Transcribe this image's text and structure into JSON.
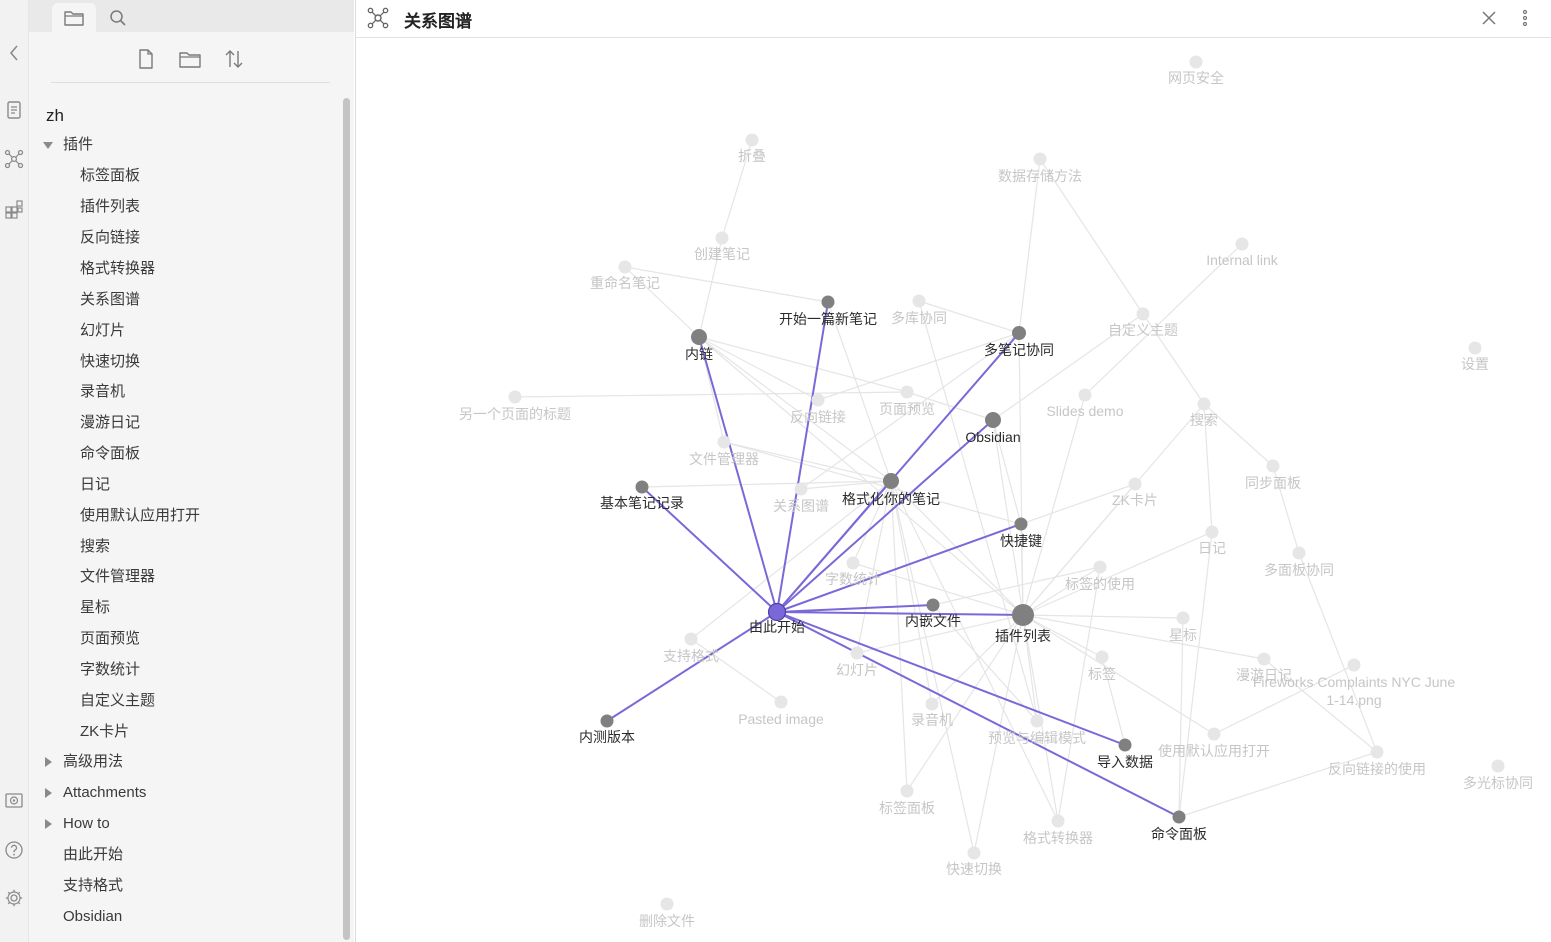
{
  "ribbon": {
    "items": [
      {
        "icon": "chevron-left-icon"
      },
      {
        "icon": "open-quick-switcher-icon"
      },
      {
        "icon": "graph-view-icon"
      },
      {
        "icon": "plugins-grid-icon"
      },
      {
        "icon": "vault-icon"
      },
      {
        "icon": "help-icon"
      },
      {
        "icon": "settings-gear-icon"
      }
    ]
  },
  "sidebar": {
    "tabs": [
      {
        "icon": "folder-icon",
        "active": true
      },
      {
        "icon": "search-icon",
        "active": false
      }
    ],
    "actions": [
      {
        "icon": "new-note-icon"
      },
      {
        "icon": "new-folder-icon"
      },
      {
        "icon": "sort-icon"
      }
    ],
    "root": "zh",
    "folder_open": "插件",
    "plugin_items": [
      "标签面板",
      "插件列表",
      "反向链接",
      "格式转换器",
      "关系图谱",
      "幻灯片",
      "快速切换",
      "录音机",
      "漫游日记",
      "命令面板",
      "日记",
      "使用默认应用打开",
      "搜索",
      "文件管理器",
      "星标",
      "页面预览",
      "字数统计",
      "自定义主题",
      "ZK卡片"
    ],
    "folders_closed": [
      "高级用法",
      "Attachments",
      "How to"
    ],
    "files": [
      "由此开始",
      "支持格式",
      "Obsidian"
    ]
  },
  "view": {
    "title": "关系图谱",
    "icon": "graph-view-icon",
    "actions": [
      {
        "icon": "close-icon"
      },
      {
        "icon": "more-options-icon"
      }
    ]
  },
  "graph": {
    "colors": {
      "edge_active": "#7b68d8",
      "edge_faint": "#e5e5e5",
      "node_active": "#7b68d8",
      "node_linked": "#808080",
      "node_faint": "#e6e6e6",
      "label_dark": "#2b2b2b",
      "label_faint": "#c6c6c6"
    },
    "center": "由此开始",
    "nodes": [
      {
        "id": "由此开始",
        "state": "active"
      },
      {
        "id": "开始一篇新笔记",
        "state": "linked"
      },
      {
        "id": "内链",
        "state": "linked"
      },
      {
        "id": "多笔记协同",
        "state": "linked"
      },
      {
        "id": "Obsidian",
        "state": "linked"
      },
      {
        "id": "格式化你的笔记",
        "state": "linked"
      },
      {
        "id": "基本笔记记录",
        "state": "linked"
      },
      {
        "id": "快捷键",
        "state": "linked"
      },
      {
        "id": "内嵌文件",
        "state": "linked"
      },
      {
        "id": "插件列表",
        "state": "linked"
      },
      {
        "id": "内测版本",
        "state": "linked"
      },
      {
        "id": "导入数据",
        "state": "linked"
      },
      {
        "id": "命令面板",
        "state": "linked"
      },
      {
        "id": "网页安全",
        "state": "faint"
      },
      {
        "id": "折叠",
        "state": "faint"
      },
      {
        "id": "数据存储方法",
        "state": "faint"
      },
      {
        "id": "创建笔记",
        "state": "faint"
      },
      {
        "id": "Internal link",
        "state": "faint"
      },
      {
        "id": "重命名笔记",
        "state": "faint"
      },
      {
        "id": "多库协同",
        "state": "faint"
      },
      {
        "id": "自定义主题",
        "state": "faint"
      },
      {
        "id": "设置",
        "state": "faint"
      },
      {
        "id": "另一个页面的标题",
        "state": "faint"
      },
      {
        "id": "页面预览",
        "state": "faint"
      },
      {
        "id": "反向链接",
        "state": "faint"
      },
      {
        "id": "Slides demo",
        "state": "faint"
      },
      {
        "id": "搜索",
        "state": "faint"
      },
      {
        "id": "文件管理器",
        "state": "faint"
      },
      {
        "id": "同步面板",
        "state": "faint"
      },
      {
        "id": "ZK卡片",
        "state": "faint"
      },
      {
        "id": "关系图谱",
        "state": "faint"
      },
      {
        "id": "日记",
        "state": "faint"
      },
      {
        "id": "多面板协同",
        "state": "faint"
      },
      {
        "id": "字数统计",
        "state": "faint"
      },
      {
        "id": "标签的使用",
        "state": "faint"
      },
      {
        "id": "星标",
        "state": "faint"
      },
      {
        "id": "支持格式",
        "state": "faint"
      },
      {
        "id": "幻灯片",
        "state": "faint"
      },
      {
        "id": "标签",
        "state": "faint"
      },
      {
        "id": "漫游日记",
        "state": "faint"
      },
      {
        "id": "Fireworks Complaints NYC June 1-14.png",
        "state": "faint"
      },
      {
        "id": "Pasted image",
        "state": "faint"
      },
      {
        "id": "录音机",
        "state": "faint"
      },
      {
        "id": "预览与编辑模式",
        "state": "faint"
      },
      {
        "id": "使用默认应用打开",
        "state": "faint"
      },
      {
        "id": "反向链接的使用",
        "state": "faint"
      },
      {
        "id": "多光标协同",
        "state": "faint"
      },
      {
        "id": "标签面板",
        "state": "faint"
      },
      {
        "id": "格式转换器",
        "state": "faint"
      },
      {
        "id": "快速切换",
        "state": "faint"
      },
      {
        "id": "删除文件",
        "state": "faint"
      }
    ],
    "active_edges": [
      [
        "由此开始",
        "开始一篇新笔记"
      ],
      [
        "由此开始",
        "内链"
      ],
      [
        "由此开始",
        "多笔记协同"
      ],
      [
        "由此开始",
        "Obsidian"
      ],
      [
        "由此开始",
        "格式化你的笔记"
      ],
      [
        "由此开始",
        "基本笔记记录"
      ],
      [
        "由此开始",
        "快捷键"
      ],
      [
        "由此开始",
        "内嵌文件"
      ],
      [
        "由此开始",
        "插件列表"
      ],
      [
        "由此开始",
        "内测版本"
      ],
      [
        "由此开始",
        "导入数据"
      ],
      [
        "由此开始",
        "命令面板"
      ]
    ],
    "faint_edges": [
      [
        "折叠",
        "创建笔记"
      ],
      [
        "创建笔记",
        "内链"
      ],
      [
        "重命名笔记",
        "开始一篇新笔记"
      ],
      [
        "重命名笔记",
        "内链"
      ],
      [
        "数据存储方法",
        "多笔记协同"
      ],
      [
        "数据存储方法",
        "自定义主题"
      ],
      [
        "Internal link",
        "Slides demo"
      ],
      [
        "多库协同",
        "多笔记协同"
      ],
      [
        "多库协同",
        "预览与编辑模式"
      ],
      [
        "自定义主题",
        "搜索"
      ],
      [
        "自定义主题",
        "Obsidian"
      ],
      [
        "另一个页面的标题",
        "页面预览"
      ],
      [
        "内链",
        "页面预览"
      ],
      [
        "内链",
        "反向链接"
      ],
      [
        "内链",
        "文件管理器"
      ],
      [
        "反向链接",
        "多笔记协同"
      ],
      [
        "页面预览",
        "Obsidian"
      ],
      [
        "文件管理器",
        "格式化你的笔记"
      ],
      [
        "文件管理器",
        "快捷键"
      ],
      [
        "关系图谱",
        "格式化你的笔记"
      ],
      [
        "关系图谱",
        "多笔记协同"
      ],
      [
        "Slides demo",
        "插件列表"
      ],
      [
        "搜索",
        "插件列表"
      ],
      [
        "搜索",
        "同步面板"
      ],
      [
        "ZK卡片",
        "插件列表"
      ],
      [
        "ZK卡片",
        "快捷键"
      ],
      [
        "日记",
        "插件列表"
      ],
      [
        "日记",
        "命令面板"
      ],
      [
        "同步面板",
        "多面板协同"
      ],
      [
        "多面板协同",
        "反向链接的使用"
      ],
      [
        "标签的使用",
        "插件列表"
      ],
      [
        "标签的使用",
        "内嵌文件"
      ],
      [
        "字数统计",
        "插件列表"
      ],
      [
        "字数统计",
        "格式化你的笔记"
      ],
      [
        "星标",
        "插件列表"
      ],
      [
        "标签",
        "插件列表"
      ],
      [
        "标签",
        "导入数据"
      ],
      [
        "幻灯片",
        "插件列表"
      ],
      [
        "幻灯片",
        "格式化你的笔记"
      ],
      [
        "漫游日记",
        "插件列表"
      ],
      [
        "漫游日记",
        "反向链接的使用"
      ],
      [
        "录音机",
        "插件列表"
      ],
      [
        "录音机",
        "格式化你的笔记"
      ],
      [
        "预览与编辑模式",
        "插件列表"
      ],
      [
        "预览与编辑模式",
        "内嵌文件"
      ],
      [
        "使用默认应用打开",
        "插件列表"
      ],
      [
        "使用默认应用打开",
        "Fireworks Complaints NYC June 1-14.png"
      ],
      [
        "反向链接的使用",
        "命令面板"
      ],
      [
        "标签面板",
        "插件列表"
      ],
      [
        "格式转换器",
        "插件列表"
      ],
      [
        "格式转换器",
        "格式化你的笔记"
      ],
      [
        "格式转换器",
        "标签的使用"
      ],
      [
        "快速切换",
        "插件列表"
      ],
      [
        "快速切换",
        "格式化你的笔记"
      ],
      [
        "支持格式",
        "格式化你的笔记"
      ],
      [
        "支持格式",
        "Pasted image"
      ],
      [
        "Obsidian",
        "插件列表"
      ],
      [
        "多笔记协同",
        "插件列表"
      ],
      [
        "快捷键",
        "插件列表"
      ],
      [
        "格式化你的笔记",
        "插件列表"
      ],
      [
        "开始一篇新笔记",
        "格式化你的笔记"
      ],
      [
        "基本笔记记录",
        "格式化你的笔记"
      ],
      [
        "内链",
        "格式化你的笔记"
      ],
      [
        "内链",
        "插件列表"
      ],
      [
        "日记",
        "搜索"
      ],
      [
        "标签面板",
        "格式化你的笔记"
      ],
      [
        "星标",
        "命令面板"
      ],
      [
        "Obsidian",
        "快捷键"
      ]
    ]
  }
}
